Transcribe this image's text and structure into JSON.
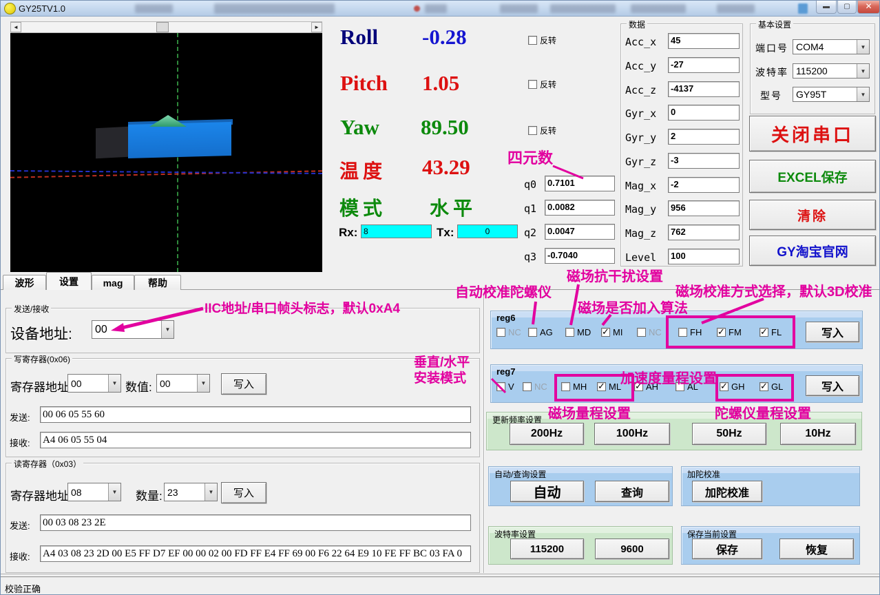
{
  "window": {
    "title": "GY25TV1.0",
    "status_text": "校验正确"
  },
  "colors": {
    "annotation": "#e2009f",
    "roll_label": "#00007a",
    "roll_value": "#1515d0",
    "pitch": "#dd1111",
    "yaw": "#0d8a0d",
    "temp": "#dd1111",
    "mode": "#0d8a0d",
    "cyan_field": "#00ffff",
    "panel_blue": "#a9cdee",
    "panel_green": "#cde7cb"
  },
  "attitude": {
    "invert_label": "反转",
    "rows": [
      {
        "label": "Roll",
        "value": "-0.28"
      },
      {
        "label": "Pitch",
        "value": "1.05"
      },
      {
        "label": "Yaw",
        "value": "89.50"
      },
      {
        "label": "温度",
        "value": "43.29"
      },
      {
        "label": "模式",
        "value": "水平"
      }
    ]
  },
  "comm": {
    "rx_label": "Rx:",
    "rx_value": "8",
    "tx_label": "Tx:",
    "tx_value": "0"
  },
  "quaternion": {
    "items": [
      {
        "label": "q0",
        "value": "0.7101"
      },
      {
        "label": "q1",
        "value": "0.0082"
      },
      {
        "label": "q2",
        "value": "0.0047"
      },
      {
        "label": "q3",
        "value": "-0.7040"
      }
    ]
  },
  "data_panel": {
    "title": "数据",
    "rows": [
      {
        "label": "Acc_x",
        "value": "45"
      },
      {
        "label": "Acc_y",
        "value": "-27"
      },
      {
        "label": "Acc_z",
        "value": "-4137"
      },
      {
        "label": "Gyr_x",
        "value": "0"
      },
      {
        "label": "Gyr_y",
        "value": "2"
      },
      {
        "label": "Gyr_z",
        "value": "-3"
      },
      {
        "label": "Mag_x",
        "value": "-2"
      },
      {
        "label": "Mag_y",
        "value": "956"
      },
      {
        "label": "Mag_z",
        "value": "762"
      },
      {
        "label": "Level",
        "value": "100"
      }
    ]
  },
  "basic_settings": {
    "title": "基本设置",
    "port_label": "端口号",
    "port_value": "COM4",
    "baud_label": "波特率",
    "baud_value": "115200",
    "model_label": "型号",
    "model_value": "GY95T",
    "close_serial": "关闭串口",
    "excel_save": "EXCEL保存",
    "clear": "清除",
    "taobao": "GY淘宝官网"
  },
  "tabs": [
    {
      "label": "波形"
    },
    {
      "label": "设置"
    },
    {
      "label": "mag"
    },
    {
      "label": "帮助"
    }
  ],
  "send_recv": {
    "title": "发送/接收",
    "device_addr_label": "设备地址:",
    "device_addr_value": "00"
  },
  "write_reg": {
    "title": "写寄存器(0x06)",
    "addr_label": "寄存器地址",
    "addr_value": "00",
    "val_label": "数值:",
    "val_value": "00",
    "write_btn": "写入",
    "send_label": "发送:",
    "send_value": "00 06 05 55 60",
    "recv_label": "接收:",
    "recv_value": "A4 06 05 55 04"
  },
  "read_reg": {
    "title": "读寄存器（0x03）",
    "addr_label": "寄存器地址",
    "addr_value": "08",
    "qty_label": "数量:",
    "qty_value": "23",
    "write_btn": "写入",
    "send_label": "发送:",
    "send_value": "00 03 08 23 2E",
    "recv_label": "接收:",
    "recv_value": "A4 03 08 23 2D 00 E5 FF D7 EF 00 00 02 00 FD FF E4 FF 69 00 F6 22 64 E9 10 FE FF BC 03 FA 0"
  },
  "reg6": {
    "title": "reg6",
    "write_btn": "写入",
    "checkboxes": [
      {
        "label": "NC",
        "checked": false,
        "disabled": true
      },
      {
        "label": "AG",
        "checked": false,
        "disabled": false
      },
      {
        "label": "MD",
        "checked": false,
        "disabled": false
      },
      {
        "label": "MI",
        "checked": true,
        "disabled": false
      },
      {
        "label": "NC",
        "checked": false,
        "disabled": true
      },
      {
        "label": "FH",
        "checked": false,
        "disabled": false
      },
      {
        "label": "FM",
        "checked": true,
        "disabled": false
      },
      {
        "label": "FL",
        "checked": true,
        "disabled": false
      }
    ]
  },
  "reg7": {
    "title": "reg7",
    "write_btn": "写入",
    "checkboxes": [
      {
        "label": "V",
        "checked": false,
        "disabled": false
      },
      {
        "label": "NC",
        "checked": false,
        "disabled": true
      },
      {
        "label": "MH",
        "checked": false,
        "disabled": false
      },
      {
        "label": "ML",
        "checked": true,
        "disabled": false
      },
      {
        "label": "AH",
        "checked": true,
        "disabled": false
      },
      {
        "label": "AL",
        "checked": false,
        "disabled": false
      },
      {
        "label": "GH",
        "checked": true,
        "disabled": false
      },
      {
        "label": "GL",
        "checked": true,
        "disabled": false
      }
    ]
  },
  "update_rate": {
    "title": "更新频率设置",
    "buttons": [
      {
        "label": "200Hz"
      },
      {
        "label": "100Hz"
      },
      {
        "label": "50Hz"
      },
      {
        "label": "10Hz"
      }
    ]
  },
  "auto_query": {
    "title": "自动/查询设置",
    "auto_btn": "自动",
    "query_btn": "查询"
  },
  "gyro_cal": {
    "title": "加陀校准",
    "button": "加陀校准"
  },
  "baud_set": {
    "title": "波特率设置",
    "btn_115200": "115200",
    "btn_9600": "9600"
  },
  "save_set": {
    "title": "保存当前设置",
    "save_btn": "保存",
    "restore_btn": "恢复"
  },
  "annotations": {
    "quaternion": "四元数",
    "iic": "IIC地址/串口帧头标志，默认0xA4",
    "gyro_auto_cal": "自动校准陀螺仪",
    "mag_interference": "磁场抗干扰设置",
    "mag_algorithm": "磁场是否加入算法",
    "mag_cal_mode": "磁场校准方式选择，默认3D校准",
    "install_mode_line1": "垂直/水平",
    "install_mode_line2": "安装模式",
    "mag_range": "磁场量程设置",
    "acc_range": "加速度量程设置",
    "gyro_range": "陀螺仪量程设置"
  }
}
